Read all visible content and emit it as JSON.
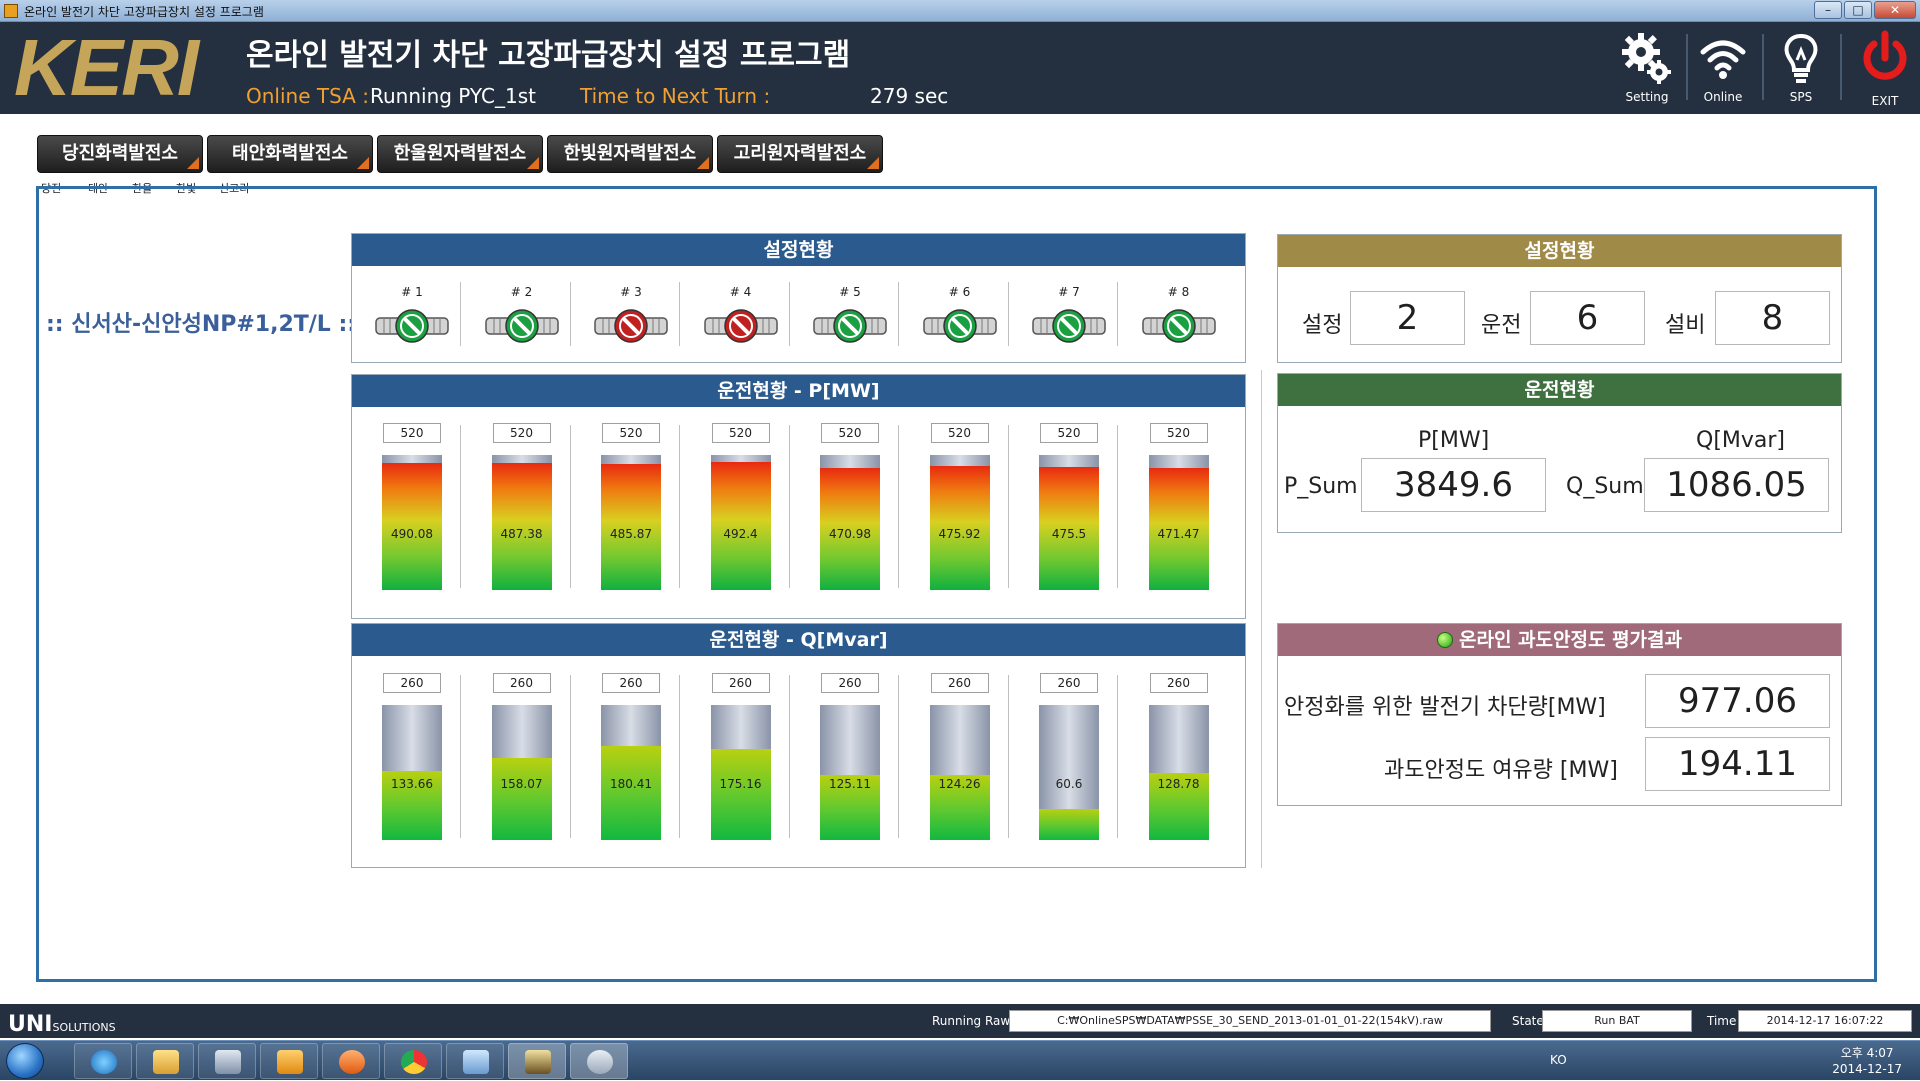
{
  "window": {
    "title": "온라인 발전기 차단 고장파급장치 설정 프로그램",
    "controls": [
      "–",
      "□",
      "✕"
    ]
  },
  "header": {
    "logo": "KERI",
    "title": "온라인 발전기 차단 고장파급장치 설정 프로그램",
    "tsa_label": "Online TSA :",
    "tsa_value": "Running PYC_1st",
    "next_turn_label": "Time to Next Turn :",
    "next_turn_value": "279 sec",
    "buttons": [
      {
        "label": "Setting",
        "icon": "gear-icon"
      },
      {
        "label": "Online",
        "icon": "wifi-icon"
      },
      {
        "label": "SPS",
        "icon": "lightbulb-icon"
      },
      {
        "label": "EXIT",
        "icon": "power-icon"
      }
    ]
  },
  "tabs": [
    {
      "label": "당진화력발전소",
      "sub": "당진"
    },
    {
      "label": "태안화력발전소",
      "sub": "태안"
    },
    {
      "label": "한울원자력발전소",
      "sub": "한울"
    },
    {
      "label": "한빛원자력발전소",
      "sub": "한빛"
    },
    {
      "label": "고리원자력발전소",
      "sub": "신고리"
    }
  ],
  "line_name": ":: 신서산-신안성NP#1,2T/L ::",
  "settings_status": {
    "title": "설정현황",
    "generators": [
      {
        "label": "# 1",
        "state": "running"
      },
      {
        "label": "# 2",
        "state": "running"
      },
      {
        "label": "# 3",
        "state": "tripped"
      },
      {
        "label": "# 4",
        "state": "tripped"
      },
      {
        "label": "# 5",
        "state": "running"
      },
      {
        "label": "# 6",
        "state": "running"
      },
      {
        "label": "# 7",
        "state": "running"
      },
      {
        "label": "# 8",
        "state": "running"
      }
    ]
  },
  "p_panel": {
    "title": "운전현황 - P[MW]",
    "ratings": [
      "520",
      "520",
      "520",
      "520",
      "520",
      "520",
      "520",
      "520"
    ],
    "values": [
      "490.08",
      "487.38",
      "485.87",
      "492.4",
      "470.98",
      "475.92",
      "475.5",
      "471.47"
    ],
    "max": 520
  },
  "q_panel": {
    "title": "운전현황 - Q[Mvar]",
    "ratings": [
      "260",
      "260",
      "260",
      "260",
      "260",
      "260",
      "260",
      "260"
    ],
    "values": [
      "133.66",
      "158.07",
      "180.41",
      "175.16",
      "125.11",
      "124.26",
      "60.6",
      "128.78"
    ],
    "max": 260
  },
  "summary_settings": {
    "title": "설정현황",
    "set_label": "설정",
    "set_value": "2",
    "run_label": "운전",
    "run_value": "6",
    "equip_label": "설비",
    "equip_value": "8"
  },
  "summary_operation": {
    "title": "운전현황",
    "p_header": "P[MW]",
    "q_header": "Q[Mvar]",
    "p_sum_label": "P_Sum",
    "p_sum_value": "3849.6",
    "q_sum_label": "Q_Sum",
    "q_sum_value": "1086.05"
  },
  "tsa_result": {
    "title": "온라인 과도안정도 평가결과",
    "trip_label": "안정화를 위한 발전기 차단량[MW]",
    "trip_value": "977.06",
    "margin_label": "과도안정도 여유량 [MW]",
    "margin_value": "194.11"
  },
  "status": {
    "logo": "UNI",
    "logo_sub": "SOLUTIONS",
    "raw_label": "Running Raw",
    "raw_value": "C:₩OnlineSPS₩DATA₩PSSE_30_SEND_2013-01-01_01-22(154kV).raw",
    "state_label": "State",
    "state_value": "Run BAT",
    "time_label": "Time",
    "time_value": "2014-12-17  16:07:22"
  },
  "taskbar": {
    "ime": "KO",
    "clock_time": "오후 4:07",
    "clock_date": "2014-12-17"
  },
  "colors": {
    "header_bg": "#243040",
    "accent_orange": "#f0a030",
    "logo_gold": "#c5a55a",
    "panel_blue": "#2b5b8e",
    "panel_gold": "#a08a48",
    "panel_green": "#3e7040",
    "panel_mauve": "#a06a7a",
    "running_green": "#1aa040",
    "tripped_red": "#c02020"
  }
}
